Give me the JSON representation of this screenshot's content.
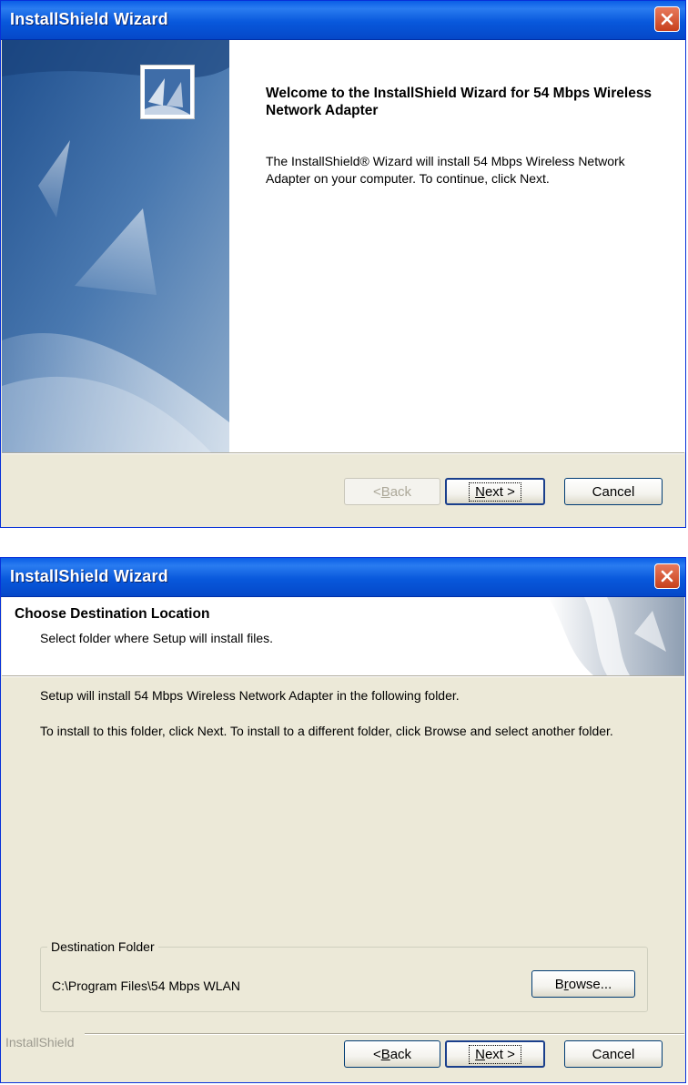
{
  "window1": {
    "title": "InstallShield Wizard",
    "welcome_title": "Welcome to the InstallShield Wizard for 54 Mbps Wireless Network Adapter",
    "body_text": "The InstallShield® Wizard will install 54 Mbps Wireless Network Adapter on your computer.  To continue, click Next.",
    "buttons": {
      "back_prefix": "< ",
      "back_accel": "B",
      "back_rest": "ack",
      "next_accel": "N",
      "next_rest": "ext >",
      "cancel": "Cancel"
    }
  },
  "window2": {
    "title": "InstallShield Wizard",
    "header_title": "Choose Destination Location",
    "header_subtitle": "Select folder where Setup will install files.",
    "paragraph1": "Setup will install 54 Mbps Wireless Network Adapter in the following folder.",
    "paragraph2": "To install to this folder, click Next. To install to a different folder, click Browse and select another folder.",
    "group_label": "Destination Folder",
    "folder_path": "C:\\Program Files\\54 Mbps WLAN",
    "browse": {
      "pre": "B",
      "accel": "r",
      "post": "owse..."
    },
    "brand": "InstallShield",
    "buttons": {
      "back_prefix": "< ",
      "back_accel": "B",
      "back_rest": "ack",
      "next_accel": "N",
      "next_rest": "ext >",
      "cancel": "Cancel"
    }
  },
  "colors": {
    "titlebar": "#0858dc",
    "dialog_bg": "#ece9d8",
    "close_button": "#c7401c",
    "art_blue": "#3c6aa0"
  },
  "icons": [
    "close-icon",
    "installshield-logo-icon"
  ]
}
